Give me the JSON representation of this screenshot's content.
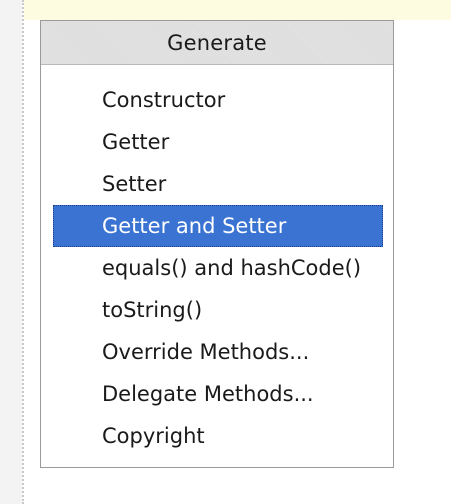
{
  "popup": {
    "title": "Generate",
    "selected_index": 3,
    "items": [
      {
        "label": "Constructor",
        "selected": false
      },
      {
        "label": "Getter",
        "selected": false
      },
      {
        "label": "Setter",
        "selected": false
      },
      {
        "label": "Getter and Setter",
        "selected": true
      },
      {
        "label": "equals() and hashCode()",
        "selected": false
      },
      {
        "label": "toString()",
        "selected": false
      },
      {
        "label": "Override Methods...",
        "selected": false
      },
      {
        "label": "Delegate Methods...",
        "selected": false
      },
      {
        "label": "Copyright",
        "selected": false
      }
    ]
  },
  "colors": {
    "selection_background": "#3b73d3",
    "selection_text": "#ffffff",
    "current_line_highlight": "#fdfbe0"
  }
}
